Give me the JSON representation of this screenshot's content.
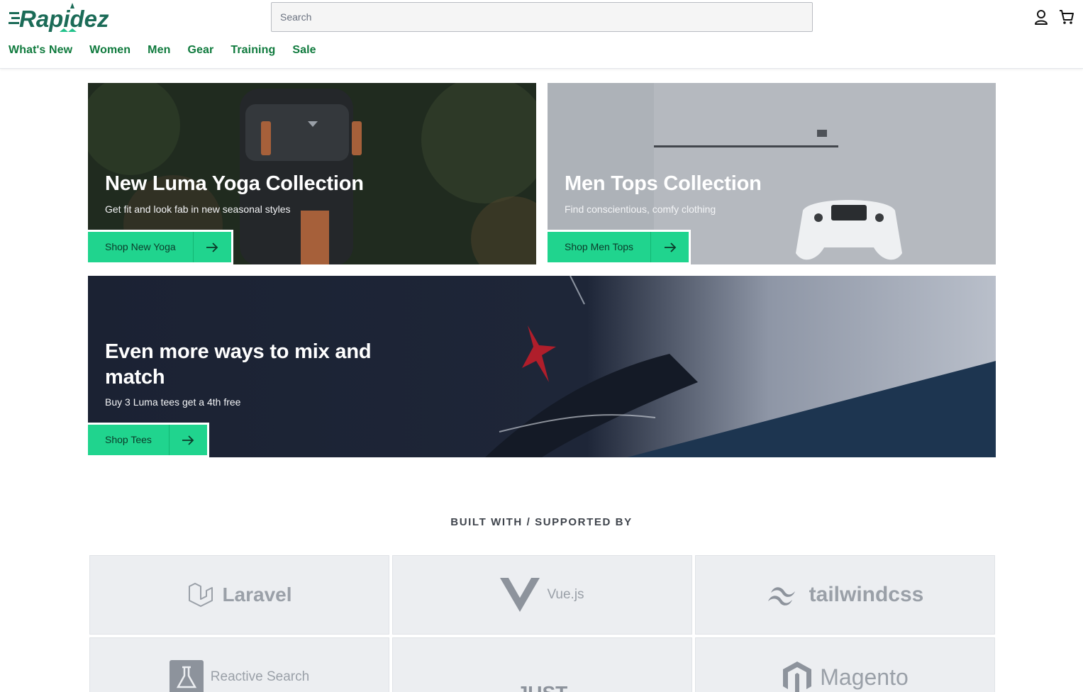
{
  "header": {
    "brand": "Rapidez",
    "search_placeholder": "Search",
    "nav": [
      "What's New",
      "Women",
      "Men",
      "Gear",
      "Training",
      "Sale"
    ]
  },
  "banners": [
    {
      "title": "New Luma Yoga Collection",
      "subtitle": "Get fit and look fab in new seasonal styles",
      "button": "Shop New Yoga"
    },
    {
      "title": "Men Tops Collection",
      "subtitle": "Find conscientious, comfy clothing",
      "button": "Shop Men Tops"
    },
    {
      "title": "Even more ways to mix and match",
      "subtitle": "Buy 3 Luma tees get a 4th free",
      "button": "Shop Tees"
    }
  ],
  "built_with": {
    "heading": "BUILT WITH / SUPPORTED BY",
    "logos": [
      "Laravel",
      "Vue.js",
      "tailwindcss",
      "Reactive Search",
      "JUST BETTER",
      "Magento"
    ]
  },
  "colors": {
    "nav_green": "#0f7a3d",
    "cta_green": "#20d48e",
    "tile_bg": "#eceef1"
  }
}
